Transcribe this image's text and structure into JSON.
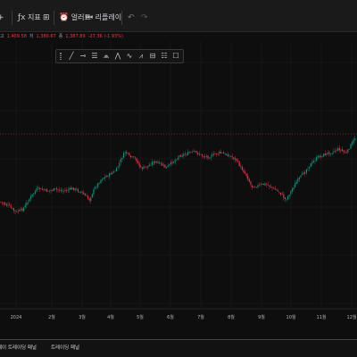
{
  "toolbar": {
    "plus_glyph": "+",
    "indicator_glyph": "ƒx",
    "indicators_label": "지표",
    "templates_glyph": "⊞",
    "alert_glyph": "⏰",
    "alert_label": "얼러트",
    "replay_glyph": "⏮",
    "replay_label": "리플레이",
    "undo_glyph": "↶",
    "redo_glyph": "↷"
  },
  "ohlc": {
    "high_label": "고",
    "high": "1,409.58",
    "low_label": "저",
    "low": "1,380.67",
    "close_label": "종",
    "close": "1,387.89",
    "change": "-27.36 (-1.93%)"
  },
  "drawing_toolbar": {
    "tools": [
      {
        "name": "trend-line-icon",
        "glyph": "╱"
      },
      {
        "name": "horizontal-ray-icon",
        "glyph": "⊸"
      },
      {
        "name": "fib-retracement-icon",
        "glyph": "☰"
      },
      {
        "name": "pitchfork-icon",
        "glyph": "⩕"
      },
      {
        "name": "pattern-icon",
        "glyph": "⋀"
      },
      {
        "name": "elliott-wave-icon",
        "glyph": "∿"
      },
      {
        "name": "projection-icon",
        "glyph": "⩘"
      },
      {
        "name": "long-position-icon",
        "glyph": "⊟"
      },
      {
        "name": "text-note-icon",
        "glyph": "☷"
      },
      {
        "name": "rectangle-icon",
        "glyph": "☐"
      }
    ]
  },
  "chart_data": {
    "type": "candlestick",
    "x_tick_labels": [
      "2024",
      "2월",
      "3월",
      "4월",
      "5월",
      "6월",
      "7월",
      "8월",
      "9월",
      "10월",
      "11월",
      "12월"
    ],
    "up_color": "#089981",
    "down_color": "#f23645",
    "background": "#0e0e0e",
    "grid": true,
    "horizontal_price_line_color": "#f23645"
  },
  "bottom_panel": {
    "tabs": [
      "레이 트레이딩 패널",
      "트레이딩 패널"
    ]
  }
}
